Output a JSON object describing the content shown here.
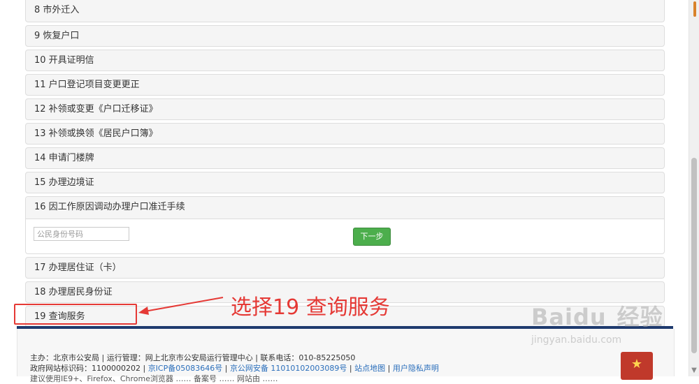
{
  "list": {
    "items_top": [
      {
        "label": "8 市外迁入"
      },
      {
        "label": "9 恢复户口"
      },
      {
        "label": "10 开具证明信"
      },
      {
        "label": "11 户口登记项目变更更正"
      },
      {
        "label": "12 补领或变更《户口迁移证》"
      },
      {
        "label": "13 补领或换领《居民户口簿》"
      },
      {
        "label": "14 申请门楼牌"
      },
      {
        "label": "15 办理边境证"
      }
    ],
    "expanded": {
      "label": "16 因工作原因调动办理户口准迁手续",
      "input_placeholder": "公民身份号码",
      "next_label": "下一步"
    },
    "items_bottom": [
      {
        "label": "17 办理居住证（卡）"
      },
      {
        "label": "18 办理居民身份证"
      },
      {
        "label": "19 查询服务"
      }
    ]
  },
  "annotation": {
    "text": "选择19 查询服务",
    "color": "#e53935"
  },
  "footer": {
    "line1": "主办：北京市公安局 | 运行管理：网上北京市公安局运行管理中心 | 联系电话：010-85225050",
    "line2_prefix": "政府网站标识码：1100000202 | ",
    "icp": "京ICP备05083646号",
    "sep1": " | ",
    "gongan": "京公网安备 11010102003089号",
    "sep2": " | ",
    "sitemap": "站点地图",
    "sep3": " | ",
    "privacy": "用户隐私声明",
    "line3": "建议使用IE9+、Firefox、Chrome浏览器  ……  备案号  ……  网站由 ……"
  },
  "watermark": {
    "brand_main": "Bai",
    "brand_paw": "du",
    "brand_cn": "经验",
    "site": "jingyan.baidu.com"
  },
  "colors": {
    "accent_green": "#4cae4c",
    "footer_bar": "#1e3a6e",
    "link": "#2a6ebb"
  }
}
